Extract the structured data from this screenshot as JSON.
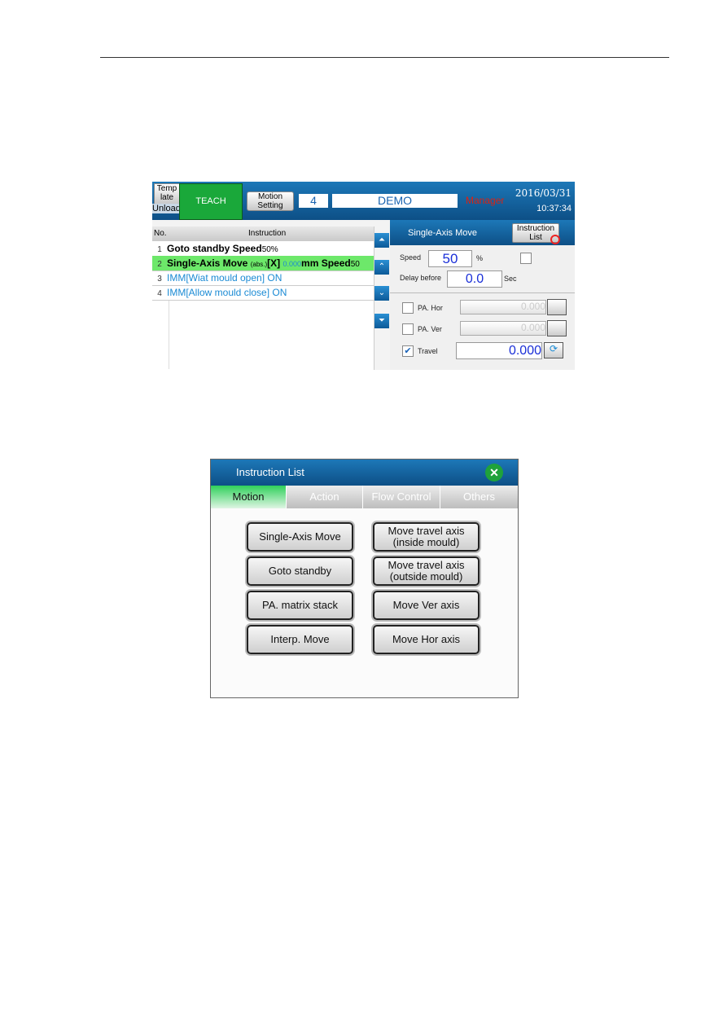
{
  "screen1": {
    "header": {
      "template_label": "Temp late",
      "unload_label": "Unload",
      "teach_label": "TEACH",
      "motion_setting_label": "Motion Setting",
      "program_number": "4",
      "program_name": "DEMO",
      "user_level": "Manager",
      "date": "2016/03/31",
      "time": "10:37:34"
    },
    "table": {
      "col_no": "No.",
      "col_instruction": "Instruction",
      "rows": [
        {
          "no": "1",
          "text": "Goto standby Speed",
          "suffix": "50%"
        },
        {
          "no": "2",
          "text": "Single-Axis Move ",
          "abs": "(abs.)",
          "axis": "[X] ",
          "value": "0.000",
          "unit": "mm Speed",
          "suffix": "50"
        },
        {
          "no": "3",
          "text": "IMM[Wiat mould open]",
          "state": " ON"
        },
        {
          "no": "4",
          "text": "IMM[Allow mould close]",
          "state": " ON"
        }
      ]
    },
    "scroll": {
      "top": "⏶",
      "up": "⌃",
      "down": "⌄",
      "bottom": "⏷"
    },
    "panel": {
      "title": "Single-Axis Move",
      "instruction_list_label": "Instruction List",
      "speed_label": "Speed",
      "speed_value": "50",
      "speed_unit": "%",
      "delay_label": "Delay before",
      "delay_value": "0.0",
      "delay_unit": "Sec",
      "axes": [
        {
          "label": "PA. Hor",
          "value": "0.000",
          "checked": false
        },
        {
          "label": "PA. Ver",
          "value": "0.000",
          "checked": false
        },
        {
          "label": "Travel",
          "value": "0.000",
          "checked": true
        }
      ]
    }
  },
  "screen2": {
    "title": "Instruction List",
    "close": "✕",
    "tabs": [
      {
        "label": "Motion",
        "active": true
      },
      {
        "label": "Action"
      },
      {
        "label": "Flow Control"
      },
      {
        "label": "Others"
      }
    ],
    "buttons": [
      "Single-Axis Move",
      "Move travel axis\n(inside mould)",
      "Goto standby",
      "Move travel axis\n(outside mould)",
      "PA. matrix stack",
      "Move Ver axis",
      "Interp. Move",
      "Move Hor axis"
    ]
  },
  "colors": {
    "header_blue": "#0d4f86",
    "teach_green": "#1aa83a",
    "selected_row": "#6de86a",
    "value_blue": "#1a2fd8"
  }
}
